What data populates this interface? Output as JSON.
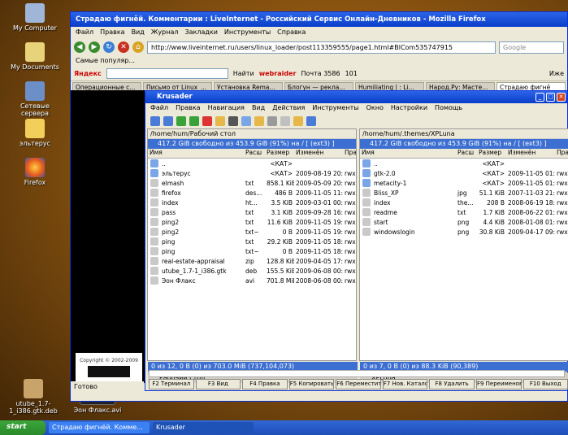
{
  "desktop": {
    "icons": [
      {
        "label": "My Computer"
      },
      {
        "label": "My Documents"
      },
      {
        "label": "Сетевые сервера"
      },
      {
        "label": "эльтерус"
      },
      {
        "label": "Firefox"
      },
      {
        "label": "utube_1.7-1_i386.gtk.deb"
      },
      {
        "label": "Эон Флакс.avi"
      }
    ]
  },
  "firefox": {
    "title": "Страдаю фигнёй. Комментарии : LiveInternet - Российский Сервис Онлайн-Дневников - Mozilla Firefox",
    "menu": [
      "Файл",
      "Правка",
      "Вид",
      "Журнал",
      "Закладки",
      "Инструменты",
      "Справка"
    ],
    "url": "http://www.liveinternet.ru/users/linux_loader/post113359555/page1.html#BlCom535747915",
    "search_placeholder": "Google",
    "bookmarks_label": "Самые популяр...",
    "yandex_bar": {
      "brand": "Яндекс",
      "find": "Найти",
      "webraider": "webraider",
      "mail": "Почта 3586",
      "count": "101",
      "more": "Иже"
    },
    "tabs": [
      {
        "label": "Операционные с..."
      },
      {
        "label": "Письмо от Linux_..."
      },
      {
        "label": "Установка Rema..."
      },
      {
        "label": "Блогун — рекла..."
      },
      {
        "label": "Humiliating | : Li..."
      },
      {
        "label": "Народ.Ру: Масте..."
      },
      {
        "label": "Страдаю фигнё"
      }
    ],
    "status": "Готово",
    "copyright": "Copyright © 2002-2009"
  },
  "krusader": {
    "title": "Krusader",
    "menu": [
      "Файл",
      "Правка",
      "Навигация",
      "Вид",
      "Действия",
      "Инструменты",
      "Окно",
      "Настройки",
      "Помощь"
    ],
    "columns": {
      "name": "Имя",
      "ext": "Расш",
      "size": "Размер",
      "modified": "Изменён",
      "perm": "Пра"
    },
    "left": {
      "path": "/home/hum/Рабочий стол",
      "free": "417.2 GiB свободно из 453.9 GiB (91%) на / [ (ext3) ]",
      "summary": "0 из 12, 0 B (0) из 703.0 MiB (737,104,073)",
      "tab": "Рабочий стол",
      "files": [
        {
          "name": "..",
          "ext": "",
          "size": "<КАТ>",
          "modified": "",
          "perm": ""
        },
        {
          "name": "эльтерус",
          "ext": "",
          "size": "<КАТ>",
          "modified": "2009-08-19 20:...",
          "perm": "rwx"
        },
        {
          "name": "elmash",
          "ext": "txt",
          "size": "858.1 KiB",
          "modified": "2009-05-09 20:...",
          "perm": "rwx"
        },
        {
          "name": "firefox",
          "ext": "des...",
          "size": "486 B",
          "modified": "2009-11-05 11:...",
          "perm": "rwx"
        },
        {
          "name": "index",
          "ext": "ht...",
          "size": "3.5 KiB",
          "modified": "2009-03-01 00:...",
          "perm": "rwx"
        },
        {
          "name": "pass",
          "ext": "txt",
          "size": "3.1 KiB",
          "modified": "2009-09-28 16:...",
          "perm": "rwx"
        },
        {
          "name": "ping2",
          "ext": "txt",
          "size": "11.6 KiB",
          "modified": "2009-11-05 19:...",
          "perm": "rwx"
        },
        {
          "name": "ping2",
          "ext": "txt~",
          "size": "0 B",
          "modified": "2009-11-05 19:...",
          "perm": "rwx"
        },
        {
          "name": "ping",
          "ext": "txt",
          "size": "29.2 KiB",
          "modified": "2009-11-05 18:...",
          "perm": "rwx"
        },
        {
          "name": "ping",
          "ext": "txt~",
          "size": "0 B",
          "modified": "2009-11-05 18:...",
          "perm": "rwx"
        },
        {
          "name": "real-estate-appraisal",
          "ext": "zip",
          "size": "128.8 KiB",
          "modified": "2009-04-05 17:...",
          "perm": "rwx"
        },
        {
          "name": "utube_1.7-1_i386.gtk",
          "ext": "deb",
          "size": "155.5 KiB",
          "modified": "2009-06-08 00:...",
          "perm": "rwx"
        },
        {
          "name": "Эон Флакс",
          "ext": "avi",
          "size": "701.8 MiB",
          "modified": "2008-06-08 00:...",
          "perm": "rwx"
        }
      ]
    },
    "right": {
      "path": "/home/hum/.themes/XPLuna",
      "free": "417.2 GiB свободно из 453.9 GiB (91%) на / [ (ext3) ]",
      "summary": "0 из 7, 0 B (0) из 88.3 KiB (90,389)",
      "tab": "XPLuna",
      "files": [
        {
          "name": "..",
          "ext": "",
          "size": "<КАТ>",
          "modified": "",
          "perm": ""
        },
        {
          "name": "gtk-2.0",
          "ext": "",
          "size": "<КАТ>",
          "modified": "2009-11-05 01:...",
          "perm": "rwx"
        },
        {
          "name": "metacity-1",
          "ext": "",
          "size": "<КАТ>",
          "modified": "2009-11-05 01:...",
          "perm": "rwx"
        },
        {
          "name": "Bliss_XP",
          "ext": "jpg",
          "size": "51.1 KiB",
          "modified": "2007-11-03 21:...",
          "perm": "rwx"
        },
        {
          "name": "index",
          "ext": "the...",
          "size": "208 B",
          "modified": "2008-06-19 18:...",
          "perm": "rwx"
        },
        {
          "name": "readme",
          "ext": "txt",
          "size": "1.7 KiB",
          "modified": "2008-06-22 01:...",
          "perm": "rwx"
        },
        {
          "name": "start",
          "ext": "png",
          "size": "4.4 KiB",
          "modified": "2008-01-08 01:...",
          "perm": "rwx"
        },
        {
          "name": "windowslogin",
          "ext": "png",
          "size": "30.8 KiB",
          "modified": "2009-04-17 09:...",
          "perm": "rwx"
        }
      ]
    },
    "fkeys": [
      "F2 Терминал",
      "F3 Вид",
      "F4 Правка",
      "F5 Копировать",
      "F6 Переместить",
      "F7 Нов. Каталог",
      "F8 Удалить",
      "F9 Переименовать",
      "F10 Выход"
    ]
  },
  "taskbar": {
    "start": "start",
    "tasks": [
      {
        "label": "Страдаю фигнёй. Комме..."
      },
      {
        "label": "Krusader"
      }
    ]
  }
}
